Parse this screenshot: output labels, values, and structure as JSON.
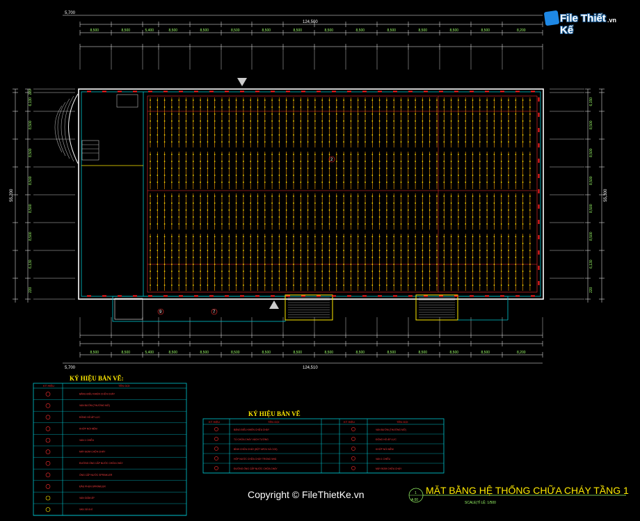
{
  "brand": {
    "name": "File Thiết Kế",
    "suffix": ".vn"
  },
  "title": "MẶT BẰNG HỆ THỐNG CHỮA CHÁY TẦNG 1",
  "scale": "SCALE|TỈ LỆ: 1/500",
  "copyright": "Copyright © FileThietKe.vn",
  "room_tags": [
    "2",
    "9",
    "7"
  ],
  "marker_tags": [
    "1",
    "A 00"
  ],
  "dimensions": {
    "total_length": "124,500",
    "total_length_bottom": "124,510",
    "offset_left": "5,700",
    "total_width_left": "55,200",
    "total_width_right": "55,300",
    "top_row": [
      "8,500",
      "8,500",
      "5,400",
      "8,500",
      "8,500",
      "8,500",
      "8,500",
      "8,500",
      "8,500",
      "8,500",
      "8,500",
      "8,500",
      "8,500",
      "8,500",
      "8,200"
    ],
    "bottom_row": [
      "8,500",
      "8,500",
      "5,400",
      "8,500",
      "8,500",
      "8,500",
      "8,500",
      "8,500",
      "8,500",
      "8,500",
      "8,500",
      "8,500",
      "8,500",
      "8,500",
      "8,200"
    ],
    "left_col": [
      "220",
      "6,130",
      "8,500",
      "8,500",
      "8,500",
      "8,500",
      "8,500",
      "6,130",
      "220"
    ],
    "right_col": [
      "6,150",
      "8,500",
      "8,500",
      "8,500",
      "8,500",
      "8,500",
      "6,130",
      "220"
    ]
  },
  "legend_left": {
    "title": "KÝ HIỆU BẢN VẼ:",
    "headers": [
      "KÝ HIỆU",
      "TÊN GỌI"
    ],
    "rows": [
      "BẢNG ĐIỀU KHIỂN CHỮA CHÁY",
      "VAN BƯỚM (THƯỜNG MỞ)",
      "ĐỒNG HỒ ÁP LỰC",
      "KHỚP NỐI MỀM",
      "VAN 1 CHIỀU",
      "MÁY BƠM CHỮA CHÁY",
      "ĐƯỜNG ỐNG CẤP NƯỚC CHỮA CHÁY",
      "ỐNG CẤP NƯỚC SPRINKLER",
      "ĐẦU PHUN SPRINKLER",
      "VAN GIẢM ÁP",
      "VAN XẢ KHÍ"
    ]
  },
  "legend_mid": {
    "title": "KÝ HIỆU BẢN VẼ",
    "headers": [
      "KÝ HIỆU",
      "TÊN GỌI",
      "KÝ HIỆU",
      "TÊN GỌI"
    ],
    "rows": [
      [
        "BẢNG ĐIỀU KHIỂN CHỮA CHÁY",
        "VAN BƯỚM (THƯỜNG MỞ)"
      ],
      [
        "TỦ CHỮA CHÁY VÁCH TƯỜNG",
        "ĐỒNG HỒ ÁP LỰC"
      ],
      [
        "BÌNH CHỮA CHÁY (BỘT MFZ4 VÀ CO2)",
        "KHỚP NỐI MỀM"
      ],
      [
        "HỘP NƯỚC CHỮA CHÁY TRONG NHÀ",
        "VAN 1 CHIỀU"
      ],
      [
        "ĐƯỜNG ỐNG CẤP NƯỚC CHỮA CHÁY",
        "MÁY BƠM CHỮA CHÁY"
      ]
    ]
  }
}
